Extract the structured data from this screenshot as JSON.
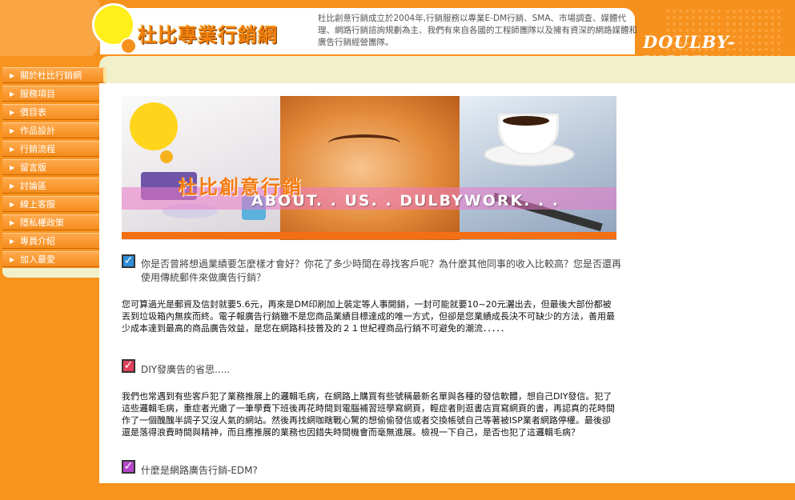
{
  "header": {
    "title": "杜比專業行銷網",
    "intro": "杜比創意行銷成立於2004年,行銷服務以專業E-DM行銷、SMA、市場調查、媒體代理、網路行銷諮詢規劃為主、我們有來自各國的工程師團隊以及擁有資深的網路媒體和廣告行銷經營團隊。",
    "brand": "DOULBY-WORK"
  },
  "sidebar": {
    "items": [
      {
        "label": "關於杜比行銷網"
      },
      {
        "label": "服務項目"
      },
      {
        "label": "價目表"
      },
      {
        "label": "作品設計"
      },
      {
        "label": "行銷流程"
      },
      {
        "label": "留言版"
      },
      {
        "label": "討論區"
      },
      {
        "label": "線上客服"
      },
      {
        "label": "隱私權政策"
      },
      {
        "label": "專員介紹"
      },
      {
        "label": "加入最愛"
      }
    ]
  },
  "banner": {
    "title": "杜比創意行銷",
    "subtitle": "ABOUT. . US. . DULBYWORK. . ."
  },
  "sections": [
    {
      "heading": "你是否曾將想過業績要怎麼樣才會好？你花了多少時間在尋找客戶呢？為什麼其他同事的收入比較高？您是否還再使用傳統郵件來做廣告行銷？",
      "body": "您可算過光是郵資及信封就要5.6元，再來是DM印刷加上裝定等人事開銷，一封可能就要10~20元灑出去，但最後大部份都被丟到垃圾箱內無疾而終。電子報廣告行銷雖不是您商品業績目標達成的唯一方式，但卻是您業績成長決不可缺少的方法，善用最少成本達到最高的商品廣告效益，是您在網路科技普及的２１世紀裡商品行銷不可避免的潮流．．．．．",
      "check_color": "#2f8ed8"
    },
    {
      "heading": "DIY發廣告的省思.....",
      "body": "我們也常遇到有些客戶犯了業務推展上的邏輯毛病，在網路上購買有些號稱最新名單與各種的發信軟體，想自己DIY發信。犯了這些邏輯毛病，重症者光繳了一筆學費下班後再花時間到電腦補習班學寫網頁，輕症者則逛書店買寫網頁的書，再認真的花時間作了一個醜醜半調子又沒人氣的網站。然後再找網咖瞎戰心驚的想偷偷發信或者交換帳號自己等著被ISP業者網路停權。最後卻還是落得浪費時間與精神，而且應推展的業務也因錯失時間機會而毫無進展。檢視一下自己，是否也犯了這邏輯毛病？",
      "check_color": "#e0405a"
    },
    {
      "heading": "什麼是網路廣告行銷-EDM?",
      "check_color": "#b547c9"
    }
  ]
}
